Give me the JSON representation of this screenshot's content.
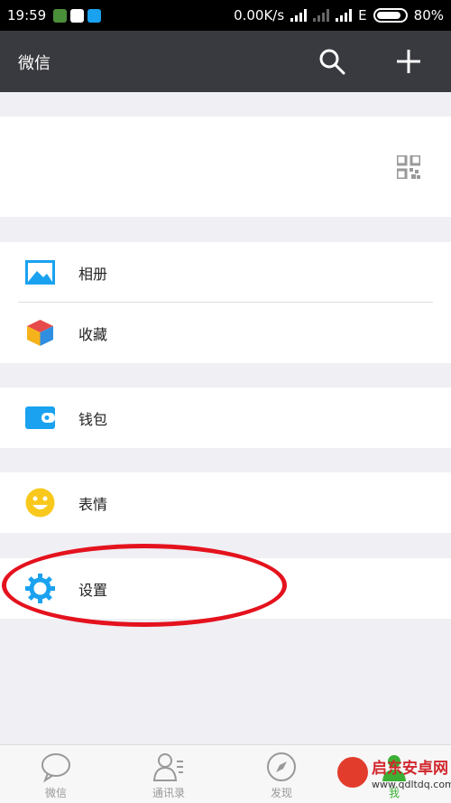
{
  "status_bar": {
    "time": "19:59",
    "network_speed": "0.00K/s",
    "network_type": "E",
    "battery": "80%"
  },
  "top_bar": {
    "title": "微信",
    "search_icon": "search-icon",
    "add_icon": "plus-icon"
  },
  "profile": {
    "qr_icon": "qr-code-icon"
  },
  "menu": {
    "album": {
      "label": "相册",
      "icon": "image-icon"
    },
    "favorites": {
      "label": "收藏",
      "icon": "cube-icon"
    },
    "wallet": {
      "label": "钱包",
      "icon": "wallet-icon"
    },
    "stickers": {
      "label": "表情",
      "icon": "smiley-icon"
    },
    "settings": {
      "label": "设置",
      "icon": "gear-icon"
    }
  },
  "tabs": [
    {
      "label": "微信",
      "icon": "chat-icon"
    },
    {
      "label": "通讯录",
      "icon": "contacts-icon"
    },
    {
      "label": "发现",
      "icon": "compass-icon"
    },
    {
      "label": "我",
      "icon": "person-icon"
    }
  ],
  "watermark": {
    "title": "启东安卓网",
    "url": "www.qdltdq.com"
  },
  "colors": {
    "top_bar_bg": "#393a3f",
    "background": "#efeff4",
    "accent_blue": "#1aa2f0",
    "annotation_red": "#e4121d",
    "active_green": "#3cb034"
  }
}
